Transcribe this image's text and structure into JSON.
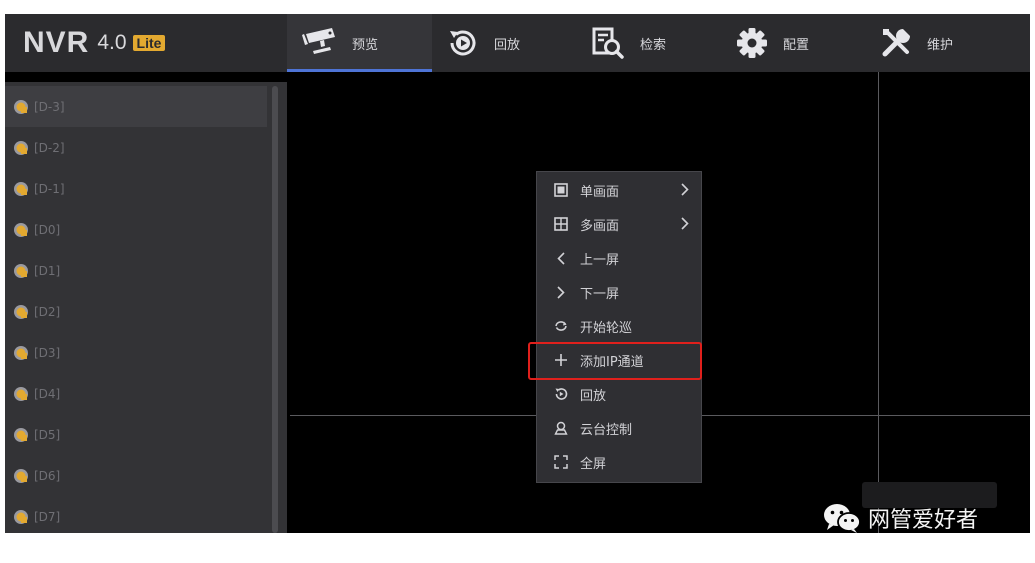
{
  "header": {
    "brand": "NVR",
    "version": "4.0",
    "edition": "Lite",
    "tabs": [
      {
        "label": "预览",
        "icon": "camera-icon",
        "active": true
      },
      {
        "label": "回放",
        "icon": "playback-icon",
        "active": false
      },
      {
        "label": "检索",
        "icon": "search-doc-icon",
        "active": false
      },
      {
        "label": "配置",
        "icon": "gear-icon",
        "active": false
      },
      {
        "label": "维护",
        "icon": "tools-icon",
        "active": false
      }
    ]
  },
  "sidebar": {
    "channels": [
      {
        "label": "[D-3]",
        "selected": true
      },
      {
        "label": "[D-2]",
        "selected": false
      },
      {
        "label": "[D-1]",
        "selected": false
      },
      {
        "label": "[D0]",
        "selected": false
      },
      {
        "label": "[D1]",
        "selected": false
      },
      {
        "label": "[D2]",
        "selected": false
      },
      {
        "label": "[D3]",
        "selected": false
      },
      {
        "label": "[D4]",
        "selected": false
      },
      {
        "label": "[D5]",
        "selected": false
      },
      {
        "label": "[D6]",
        "selected": false
      },
      {
        "label": "[D7]",
        "selected": false
      }
    ]
  },
  "context_menu": {
    "items": [
      {
        "label": "单画面",
        "icon": "single-screen-icon",
        "has_submenu": true
      },
      {
        "label": "多画面",
        "icon": "multi-screen-icon",
        "has_submenu": true
      },
      {
        "label": "上一屏",
        "icon": "chevron-left-icon",
        "has_submenu": false
      },
      {
        "label": "下一屏",
        "icon": "chevron-right-icon",
        "has_submenu": false
      },
      {
        "label": "开始轮巡",
        "icon": "cycle-icon",
        "has_submenu": false
      },
      {
        "label": "添加IP通道",
        "icon": "plus-icon",
        "has_submenu": false,
        "highlighted": true
      },
      {
        "label": "回放",
        "icon": "playback-icon",
        "has_submenu": false
      },
      {
        "label": "云台控制",
        "icon": "ptz-icon",
        "has_submenu": false
      },
      {
        "label": "全屏",
        "icon": "fullscreen-icon",
        "has_submenu": false
      }
    ]
  },
  "watermark": {
    "text": "网管爱好者",
    "icon": "wechat-icon"
  },
  "colors": {
    "accent": "#4e74d6",
    "highlight": "#e0201c",
    "channel_icon": "#e3a930"
  }
}
